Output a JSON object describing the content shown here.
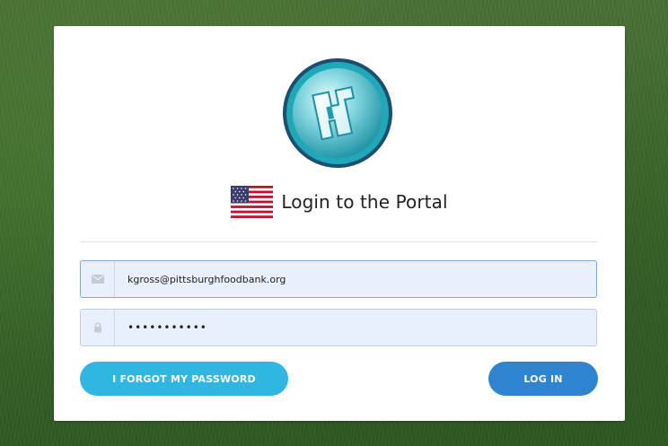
{
  "heading": "Login to the Portal",
  "email": {
    "value": "kgross@pittsburghfoodbank.org",
    "placeholder": "",
    "icon": "envelope-icon"
  },
  "password": {
    "value": "...........",
    "icon": "lock-icon"
  },
  "buttons": {
    "forgot_label": "I FORGOT MY PASSWORD",
    "login_label": "LOG IN"
  },
  "colors": {
    "forgot_button": "#2fb7e1",
    "login_button": "#2f84cf",
    "field_background": "#e8f0fe",
    "logo_ring": "#1ea8b8"
  }
}
